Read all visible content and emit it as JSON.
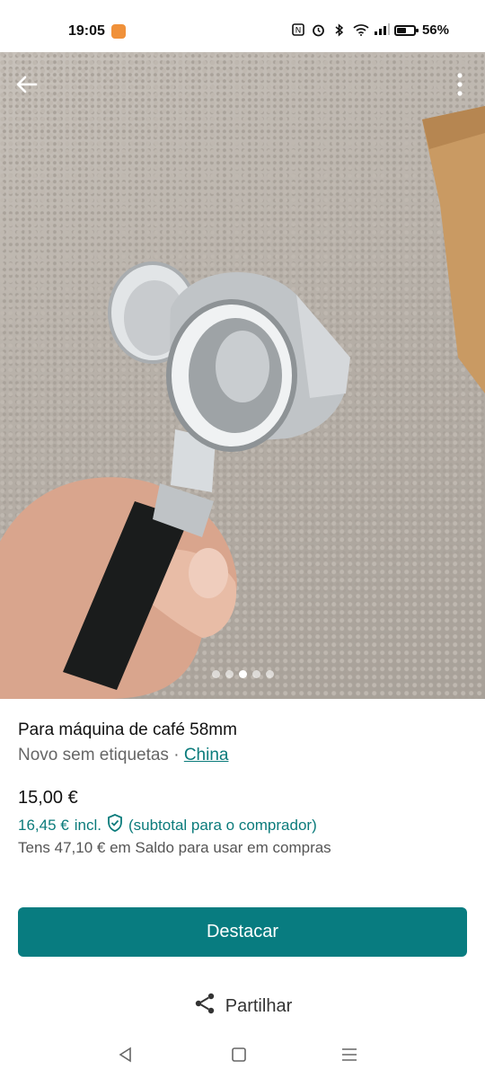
{
  "status_bar": {
    "time": "19:05",
    "battery_percent": "56%",
    "battery_level": 0.56,
    "icons": [
      "app-notification-icon",
      "nfc-icon",
      "alarm-icon",
      "bluetooth-icon",
      "wifi-icon",
      "signal-icon",
      "battery-icon"
    ]
  },
  "gallery": {
    "image_count": 5,
    "active_index": 2
  },
  "listing": {
    "title": "Para máquina de café 58mm",
    "condition": "Novo sem etiquetas",
    "separator": " · ",
    "brand": "China",
    "price": "15,00 €",
    "price_incl": "16,45 €",
    "incl_label": "incl.",
    "buyer_note": "(subtotal para o comprador)",
    "balance_note": "Tens 47,10 € em Saldo para usar em compras"
  },
  "actions": {
    "highlight": "Destacar",
    "share": "Partilhar"
  },
  "colors": {
    "accent": "#087c80",
    "link": "#0b7b7b"
  }
}
